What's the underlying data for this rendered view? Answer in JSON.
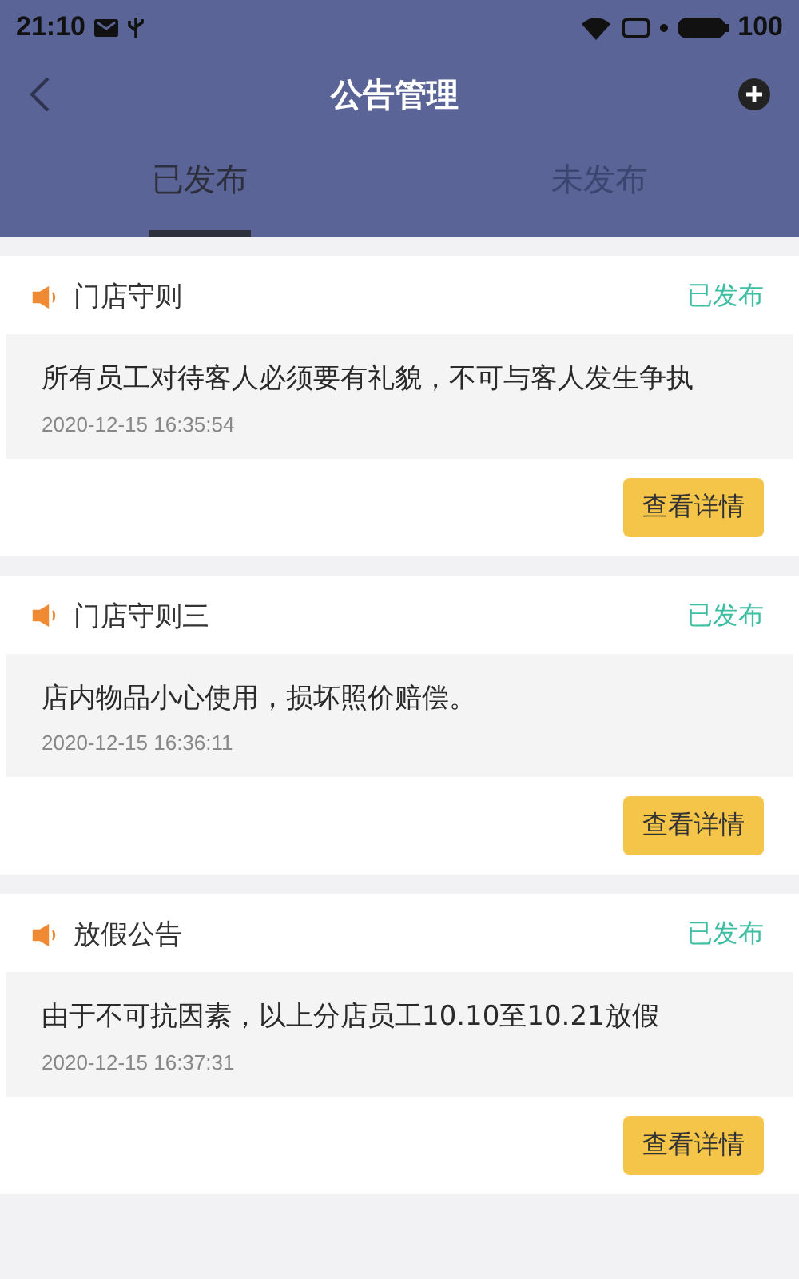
{
  "status_bar": {
    "time": "21:10",
    "battery": "100"
  },
  "nav": {
    "title": "公告管理"
  },
  "tabs": [
    {
      "label": "已发布",
      "selected": true
    },
    {
      "label": "未发布",
      "selected": false
    }
  ],
  "notices": [
    {
      "title": "门店守则",
      "status": "已发布",
      "content": "所有员工对待客人必须要有礼貌，不可与客人发生争执",
      "time": "2020-12-15 16:35:54",
      "button": "查看详情"
    },
    {
      "title": "门店守则三",
      "status": "已发布",
      "content": "店内物品小心使用，损坏照价赔偿。",
      "time": "2020-12-15 16:36:11",
      "button": "查看详情"
    },
    {
      "title": "放假公告",
      "status": "已发布",
      "content": "由于不可抗因素，以上分店员工10.10至10.21放假",
      "time": "2020-12-15 16:37:31",
      "button": "查看详情"
    }
  ]
}
